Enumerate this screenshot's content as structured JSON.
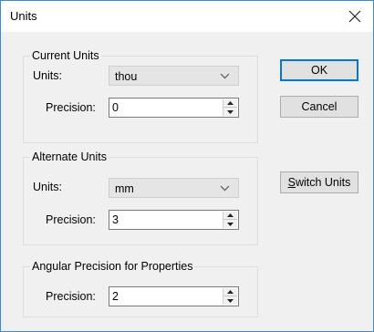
{
  "window": {
    "title": "Units"
  },
  "current_units": {
    "legend": "Current Units",
    "units_label": "Units:",
    "units_value": "thou",
    "precision_label": "Precision:",
    "precision_value": "0"
  },
  "alternate_units": {
    "legend": "Alternate Units",
    "units_label": "Units:",
    "units_value": "mm",
    "precision_label": "Precision:",
    "precision_value": "3"
  },
  "angular": {
    "legend": "Angular Precision for Properties",
    "precision_label": "Precision:",
    "precision_value": "2"
  },
  "buttons": {
    "ok": "OK",
    "cancel": "Cancel",
    "switch_units_mnemonic": "S",
    "switch_units_rest": "witch Units"
  },
  "icons": {
    "close": "close-icon",
    "dropdown": "chevron-down-icon",
    "spin_up": "spin-up-icon",
    "spin_down": "spin-down-icon"
  },
  "colors": {
    "accent": "#0078d7",
    "window_border": "#3a8ad6",
    "dialog_background": "#f0f0f0"
  }
}
